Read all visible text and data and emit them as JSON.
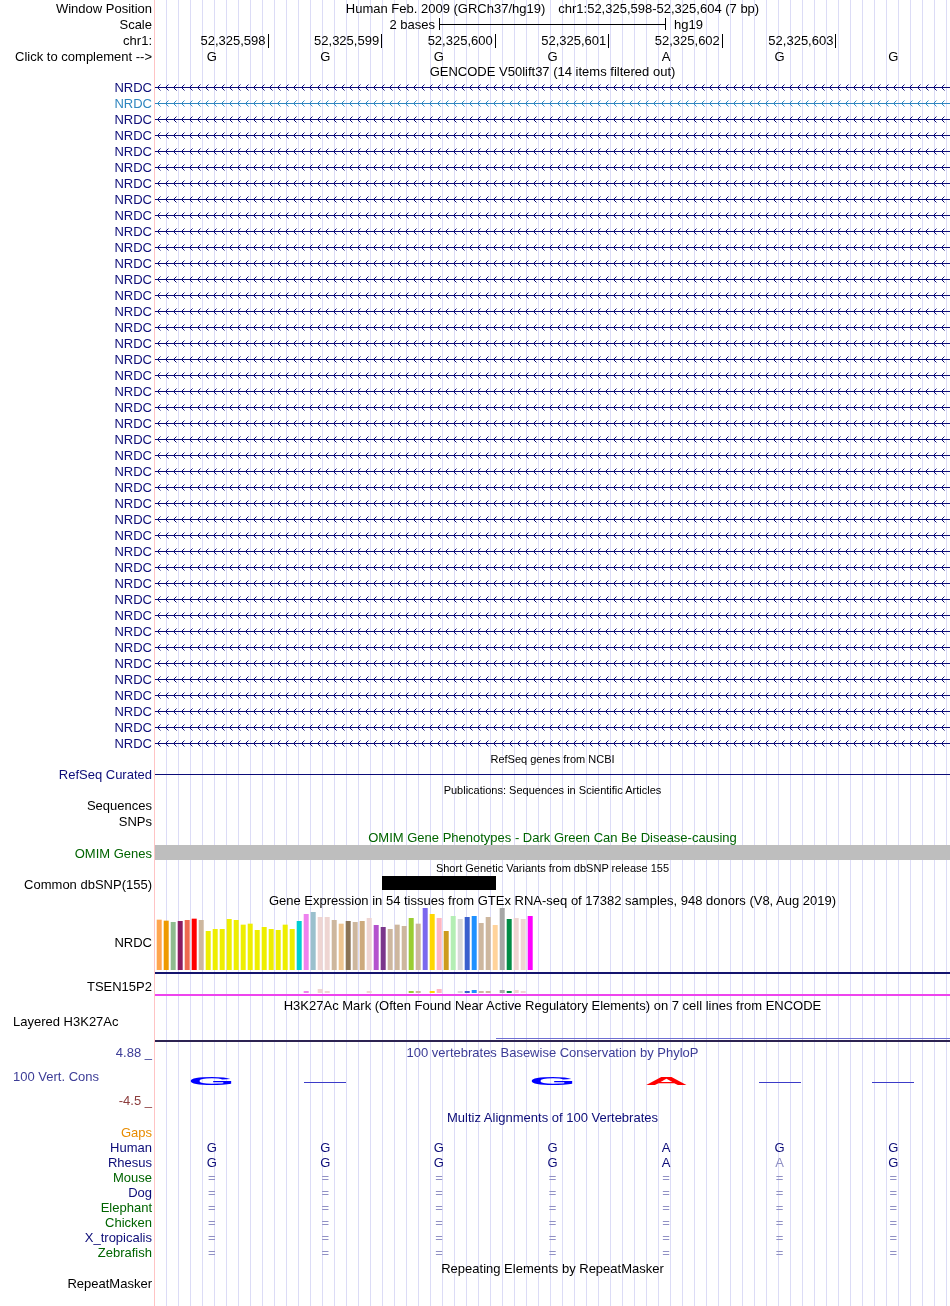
{
  "position": {
    "label": "Window Position",
    "assembly": "Human Feb. 2009 (GRCh37/hg19)",
    "range": "chr1:52,325,598-52,325,604 (7 bp)"
  },
  "scale": {
    "label": "Scale",
    "span": "2 bases",
    "assembly": "hg19"
  },
  "ruler": {
    "label": "chr1:",
    "positions": [
      "52,325,598",
      "52,325,599",
      "52,325,600",
      "52,325,601",
      "52,325,602",
      "52,325,603"
    ]
  },
  "sequence": {
    "label": "Click to complement -->",
    "bases": [
      "G",
      "G",
      "G",
      "G",
      "A",
      "G",
      "G"
    ]
  },
  "gencode": {
    "title": "GENCODE V50lift37 (14 items filtered out)",
    "items": [
      {
        "name": "NRDC",
        "color": "#0c0c78"
      },
      {
        "name": "NRDC",
        "color": "#2f86c0"
      },
      {
        "name": "NRDC",
        "color": "#0c0c78"
      },
      {
        "name": "NRDC",
        "color": "#0c0c78"
      },
      {
        "name": "NRDC",
        "color": "#0c0c78"
      },
      {
        "name": "NRDC",
        "color": "#0c0c78"
      },
      {
        "name": "NRDC",
        "color": "#0c0c78"
      },
      {
        "name": "NRDC",
        "color": "#0c0c78"
      },
      {
        "name": "NRDC",
        "color": "#0c0c78"
      },
      {
        "name": "NRDC",
        "color": "#0c0c78"
      },
      {
        "name": "NRDC",
        "color": "#0c0c78"
      },
      {
        "name": "NRDC",
        "color": "#0c0c78"
      },
      {
        "name": "NRDC",
        "color": "#0c0c78"
      },
      {
        "name": "NRDC",
        "color": "#0c0c78"
      },
      {
        "name": "NRDC",
        "color": "#0c0c78"
      },
      {
        "name": "NRDC",
        "color": "#0c0c78"
      },
      {
        "name": "NRDC",
        "color": "#0c0c78"
      },
      {
        "name": "NRDC",
        "color": "#0c0c78"
      },
      {
        "name": "NRDC",
        "color": "#0c0c78"
      },
      {
        "name": "NRDC",
        "color": "#0c0c78"
      },
      {
        "name": "NRDC",
        "color": "#0c0c78"
      },
      {
        "name": "NRDC",
        "color": "#0c0c78"
      },
      {
        "name": "NRDC",
        "color": "#0c0c78"
      },
      {
        "name": "NRDC",
        "color": "#0c0c78"
      },
      {
        "name": "NRDC",
        "color": "#0c0c78"
      },
      {
        "name": "NRDC",
        "color": "#0c0c78"
      },
      {
        "name": "NRDC",
        "color": "#0c0c78"
      },
      {
        "name": "NRDC",
        "color": "#0c0c78"
      },
      {
        "name": "NRDC",
        "color": "#0c0c78"
      },
      {
        "name": "NRDC",
        "color": "#0c0c78"
      },
      {
        "name": "NRDC",
        "color": "#0c0c78"
      },
      {
        "name": "NRDC",
        "color": "#0c0c78"
      },
      {
        "name": "NRDC",
        "color": "#0c0c78"
      },
      {
        "name": "NRDC",
        "color": "#0c0c78"
      },
      {
        "name": "NRDC",
        "color": "#0c0c78"
      },
      {
        "name": "NRDC",
        "color": "#0c0c78"
      },
      {
        "name": "NRDC",
        "color": "#0c0c78"
      },
      {
        "name": "NRDC",
        "color": "#0c0c78"
      },
      {
        "name": "NRDC",
        "color": "#0c0c78"
      },
      {
        "name": "NRDC",
        "color": "#0c0c78"
      },
      {
        "name": "NRDC",
        "color": "#0c0c78"
      },
      {
        "name": "NRDC",
        "color": "#0c0c78"
      }
    ]
  },
  "refseq": {
    "title": "RefSeq genes from NCBI",
    "label": "RefSeq Curated"
  },
  "publications": {
    "title": "Publications: Sequences in Scientific Articles",
    "tracks": [
      "Sequences",
      "SNPs"
    ]
  },
  "omim": {
    "title": "OMIM Gene Phenotypes - Dark Green Can Be Disease-causing",
    "label": "OMIM Genes"
  },
  "dbsnp": {
    "title": "Short Genetic Variants from dbSNP release 155",
    "label": "Common dbSNP(155)"
  },
  "gtex": {
    "title": "Gene Expression in 54 tissues from GTEx RNA-seq of 17382 samples, 948 donors (V8, Aug 2019)",
    "genes": [
      "NRDC",
      "TSEN15P2"
    ]
  },
  "h3k27ac": {
    "title": "H3K27Ac Mark (Often Found Near Active Regulatory Elements) on 7 cell lines from ENCODE",
    "label": "Layered H3K27Ac"
  },
  "phylop": {
    "title": "100 vertebrates Basewise Conservation by PhyloP",
    "max": "4.88 _",
    "label": "100 Vert. Cons",
    "min": "-4.5 _",
    "logo": [
      {
        "kind": "letter",
        "text": "G",
        "color": "#0000ff"
      },
      {
        "kind": "dash"
      },
      {
        "kind": "empty"
      },
      {
        "kind": "letter",
        "text": "G",
        "color": "#0000ff"
      },
      {
        "kind": "letter",
        "text": "A",
        "color": "#ff0000"
      },
      {
        "kind": "dash"
      },
      {
        "kind": "dash"
      }
    ]
  },
  "multiz": {
    "title": "Multiz Alignments of 100 Vertebrates",
    "gaps_label": "Gaps",
    "species": [
      {
        "name": "Human",
        "color": "#0c0c78",
        "bases": [
          {
            "text": "G",
            "faint": false
          },
          {
            "text": "G",
            "faint": false
          },
          {
            "text": "G",
            "faint": false
          },
          {
            "text": "G",
            "faint": false
          },
          {
            "text": "A",
            "faint": false
          },
          {
            "text": "G",
            "faint": false
          },
          {
            "text": "G",
            "faint": false
          }
        ]
      },
      {
        "name": "Rhesus",
        "color": "#0c0c78",
        "bases": [
          {
            "text": "G",
            "faint": false
          },
          {
            "text": "G",
            "faint": false
          },
          {
            "text": "G",
            "faint": false
          },
          {
            "text": "G",
            "faint": false
          },
          {
            "text": "A",
            "faint": false
          },
          {
            "text": "A",
            "faint": true
          },
          {
            "text": "G",
            "faint": false
          }
        ]
      },
      {
        "name": "Mouse",
        "color": "#006400",
        "bases": [
          {
            "text": "=",
            "faint": true
          },
          {
            "text": "=",
            "faint": true
          },
          {
            "text": "=",
            "faint": true
          },
          {
            "text": "=",
            "faint": true
          },
          {
            "text": "=",
            "faint": true
          },
          {
            "text": "=",
            "faint": true
          },
          {
            "text": "=",
            "faint": true
          }
        ]
      },
      {
        "name": "Dog",
        "color": "#0c0c78",
        "bases": [
          {
            "text": "=",
            "faint": true
          },
          {
            "text": "=",
            "faint": true
          },
          {
            "text": "=",
            "faint": true
          },
          {
            "text": "=",
            "faint": true
          },
          {
            "text": "=",
            "faint": true
          },
          {
            "text": "=",
            "faint": true
          },
          {
            "text": "=",
            "faint": true
          }
        ]
      },
      {
        "name": "Elephant",
        "color": "#006400",
        "bases": [
          {
            "text": "=",
            "faint": true
          },
          {
            "text": "=",
            "faint": true
          },
          {
            "text": "=",
            "faint": true
          },
          {
            "text": "=",
            "faint": true
          },
          {
            "text": "=",
            "faint": true
          },
          {
            "text": "=",
            "faint": true
          },
          {
            "text": "=",
            "faint": true
          }
        ]
      },
      {
        "name": "Chicken",
        "color": "#006400",
        "bases": [
          {
            "text": "=",
            "faint": true
          },
          {
            "text": "=",
            "faint": true
          },
          {
            "text": "=",
            "faint": true
          },
          {
            "text": "=",
            "faint": true
          },
          {
            "text": "=",
            "faint": true
          },
          {
            "text": "=",
            "faint": true
          },
          {
            "text": "=",
            "faint": true
          }
        ]
      },
      {
        "name": "X_tropicalis",
        "color": "#0c0c78",
        "bases": [
          {
            "text": "=",
            "faint": true
          },
          {
            "text": "=",
            "faint": true
          },
          {
            "text": "=",
            "faint": true
          },
          {
            "text": "=",
            "faint": true
          },
          {
            "text": "=",
            "faint": true
          },
          {
            "text": "=",
            "faint": true
          },
          {
            "text": "=",
            "faint": true
          }
        ]
      },
      {
        "name": "Zebrafish",
        "color": "#006400",
        "bases": [
          {
            "text": "=",
            "faint": true
          },
          {
            "text": "=",
            "faint": true
          },
          {
            "text": "=",
            "faint": true
          },
          {
            "text": "=",
            "faint": true
          },
          {
            "text": "=",
            "faint": true
          },
          {
            "text": "=",
            "faint": true
          },
          {
            "text": "=",
            "faint": true
          }
        ]
      }
    ]
  },
  "repeatmasker": {
    "title": "Repeating Elements by RepeatMasker",
    "label": "RepeatMasker"
  }
}
